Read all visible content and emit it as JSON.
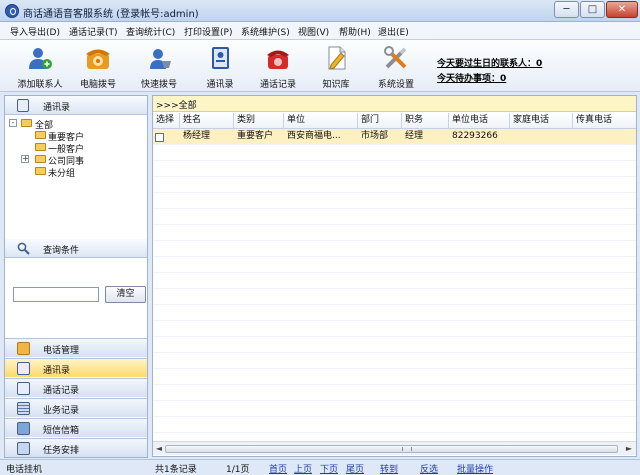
{
  "window": {
    "title": "商话通语音客服系统 (登录帐号:admin)",
    "minimize": "─",
    "maximize": "□",
    "close": "✕"
  },
  "menu": [
    "导入导出(D)",
    "通话记录(T)",
    "查询统计(C)",
    "打印设置(P)",
    "系统维护(S)",
    "视图(V)",
    "帮助(H)",
    "退出(E)"
  ],
  "toolbar": {
    "buttons": [
      {
        "label": "添加联系人",
        "icon": "add-contact-icon"
      },
      {
        "label": "电脑拨号",
        "icon": "phone-dial-icon"
      },
      {
        "label": "快速拨号",
        "icon": "quick-dial-icon"
      },
      {
        "label": "通讯录",
        "icon": "address-book-icon"
      },
      {
        "label": "通话记录",
        "icon": "call-log-icon"
      },
      {
        "label": "知识库",
        "icon": "knowledge-base-icon"
      },
      {
        "label": "系统设置",
        "icon": "settings-tools-icon"
      }
    ],
    "notices": [
      "今天要过生日的联系人：0",
      "今天待办事项：0"
    ]
  },
  "sidebar": {
    "header": "通讯录",
    "tree": {
      "root": "全部",
      "expander_minus": "-",
      "expander_plus": "+",
      "children": [
        "重要客户",
        "一般客户",
        "公司同事",
        "未分组"
      ]
    },
    "query": {
      "title": "查询条件",
      "input_value": "",
      "button": "清空"
    },
    "nav": [
      {
        "label": "电话管理",
        "active": false,
        "icon": "phone-manage-icon"
      },
      {
        "label": "通讯录",
        "active": true,
        "icon": "address-book-icon"
      },
      {
        "label": "通话记录",
        "active": false,
        "icon": "call-log-icon"
      },
      {
        "label": "业务记录",
        "active": false,
        "icon": "business-record-icon"
      },
      {
        "label": "短信信箱",
        "active": false,
        "icon": "sms-inbox-icon"
      },
      {
        "label": "任务安排",
        "active": false,
        "icon": "task-schedule-icon"
      }
    ]
  },
  "main": {
    "path": ">>>全部",
    "columns": [
      "选择",
      "姓名",
      "类别",
      "单位",
      "部门",
      "职务",
      "单位电话",
      "家庭电话",
      "传真电话"
    ],
    "rows": [
      {
        "name": "杨经理",
        "category": "重要客户",
        "company": "西安商福电...",
        "dept": "市场部",
        "title": "经理",
        "office_phone": "82293266",
        "home_phone": "",
        "fax": ""
      }
    ],
    "scroll_left": "◄",
    "scroll_right": "►"
  },
  "status": {
    "left": "电话挂机",
    "count": "共1条记录",
    "pages": "1/1页",
    "links": [
      "首页",
      "上页",
      "下页",
      "尾页",
      "转到",
      "反选",
      "批量操作"
    ]
  }
}
